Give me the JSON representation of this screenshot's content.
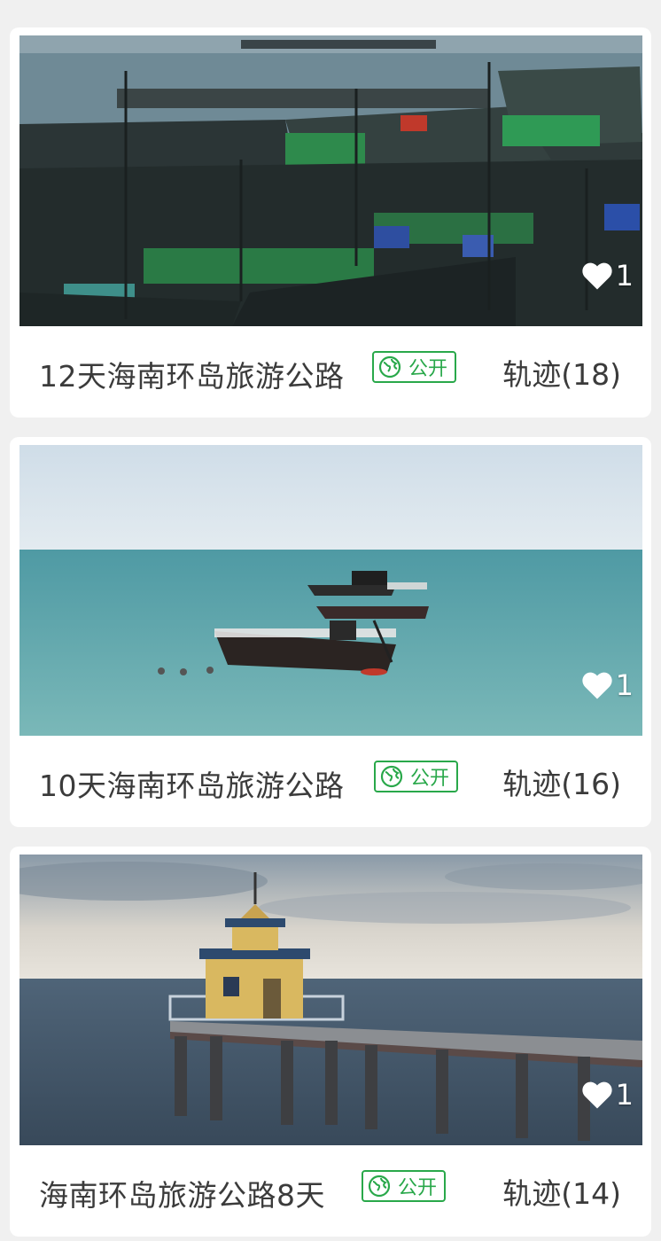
{
  "cards": [
    {
      "title": "12天海南环岛旅游公路",
      "badge": "公开",
      "tracks": "轨迹(18)",
      "likes": "1",
      "image": "fishing-boats-harbor"
    },
    {
      "title": "10天海南环岛旅游公路",
      "badge": "公开",
      "tracks": "轨迹(16)",
      "likes": "1",
      "image": "boats-on-sea"
    },
    {
      "title": "海南环岛旅游公路8天",
      "badge": "公开",
      "tracks": "轨迹(14)",
      "likes": "1",
      "image": "pier-lighthouse"
    }
  ],
  "icons": {
    "like": "heart-icon",
    "visibility": "globe-icon"
  },
  "colors": {
    "badge": "#29a84a",
    "text": "#3b3b3b",
    "background": "#f0f0f0"
  }
}
